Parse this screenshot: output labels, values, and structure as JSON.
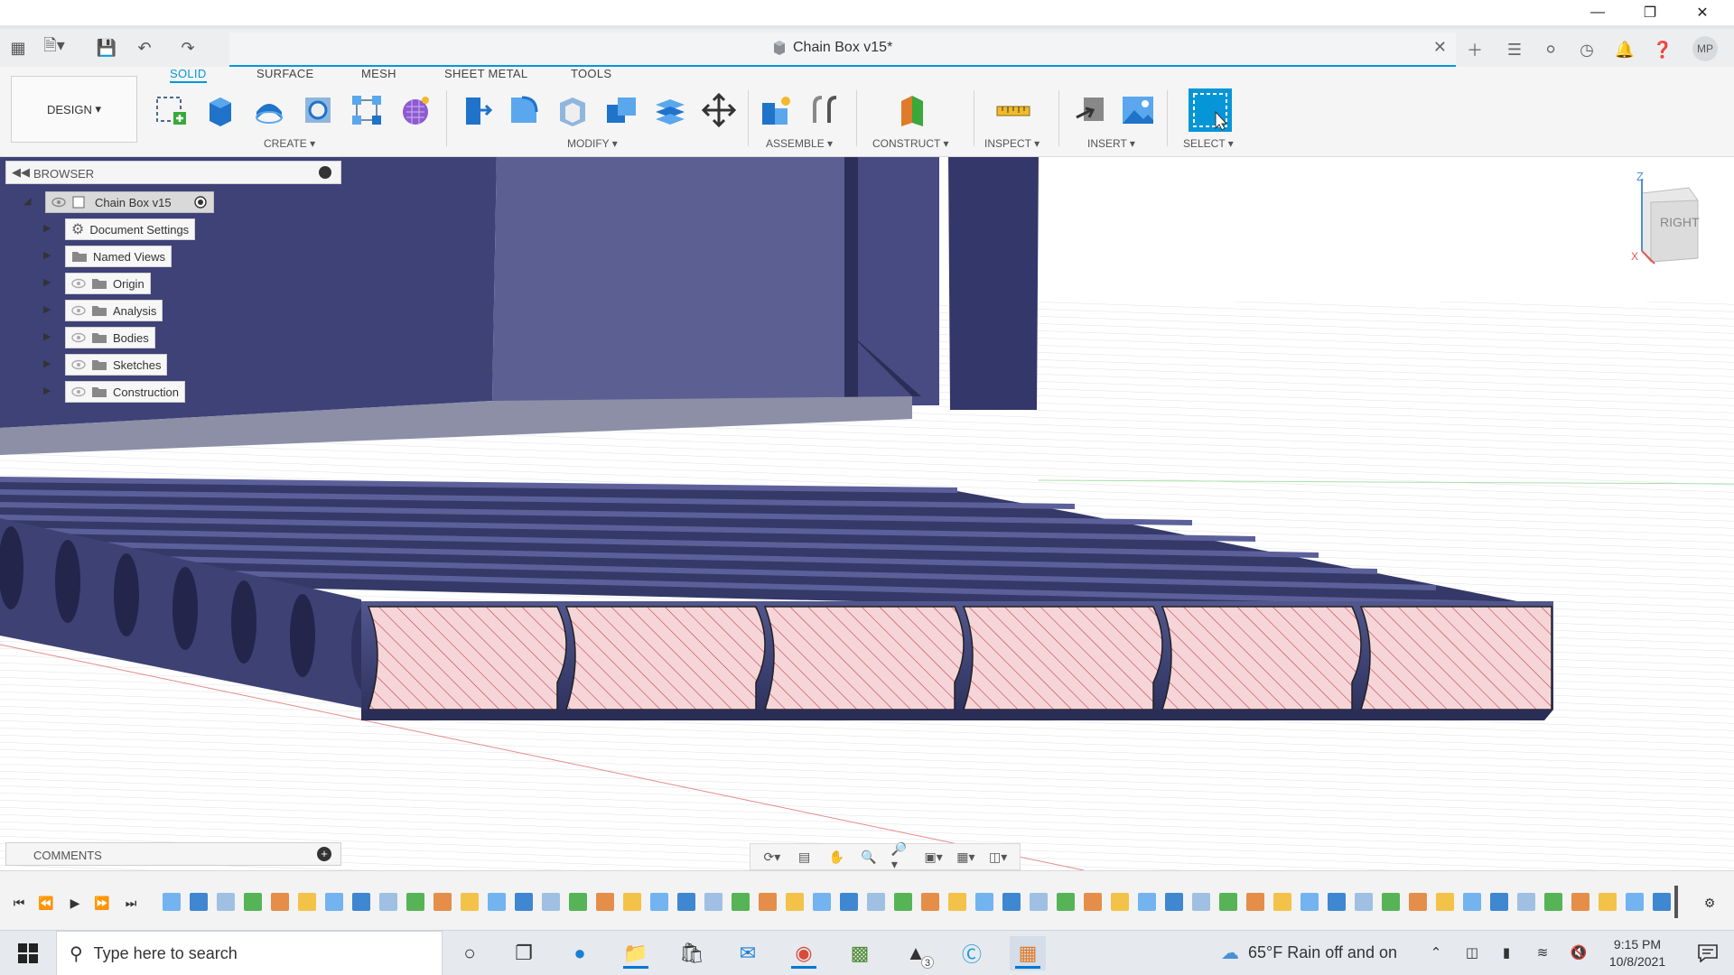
{
  "window": {
    "doc_title": "Chain Box v15*"
  },
  "toolbar": {
    "design_label": "DESIGN",
    "tabs": [
      {
        "label": "SOLID",
        "active": true
      },
      {
        "label": "SURFACE"
      },
      {
        "label": "MESH"
      },
      {
        "label": "SHEET METAL"
      },
      {
        "label": "TOOLS"
      }
    ],
    "groups": {
      "create": "CREATE",
      "modify": "MODIFY",
      "assemble": "ASSEMBLE",
      "construct": "CONSTRUCT",
      "inspect": "INSPECT",
      "insert": "INSERT",
      "select": "SELECT"
    }
  },
  "browser": {
    "title": "BROWSER",
    "root": "Chain Box v15",
    "items": [
      {
        "label": "Document Settings",
        "icon": "gear-icon"
      },
      {
        "label": "Named Views",
        "icon": "folder-icon"
      },
      {
        "label": "Origin",
        "icon": "folder-icon"
      },
      {
        "label": "Analysis",
        "icon": "folder-icon"
      },
      {
        "label": "Bodies",
        "icon": "folder-icon"
      },
      {
        "label": "Sketches",
        "icon": "folder-icon"
      },
      {
        "label": "Construction",
        "icon": "folder-icon"
      }
    ]
  },
  "comments": {
    "title": "COMMENTS"
  },
  "viewcube": {
    "face": "RIGHT",
    "axis_z": "Z",
    "axis_x": "X"
  },
  "user": {
    "initials": "MP"
  },
  "taskbar": {
    "search_placeholder": "Type here to search",
    "weather": "65°F  Rain off and on",
    "time": "9:15 PM",
    "date": "10/8/2021",
    "badge": "3"
  },
  "colors": {
    "accent": "#0696d7",
    "body": "#3f4377",
    "section_fill": "#f6d5d8",
    "section_hatch": "#c0414a",
    "grid": "#d9d9d9"
  }
}
